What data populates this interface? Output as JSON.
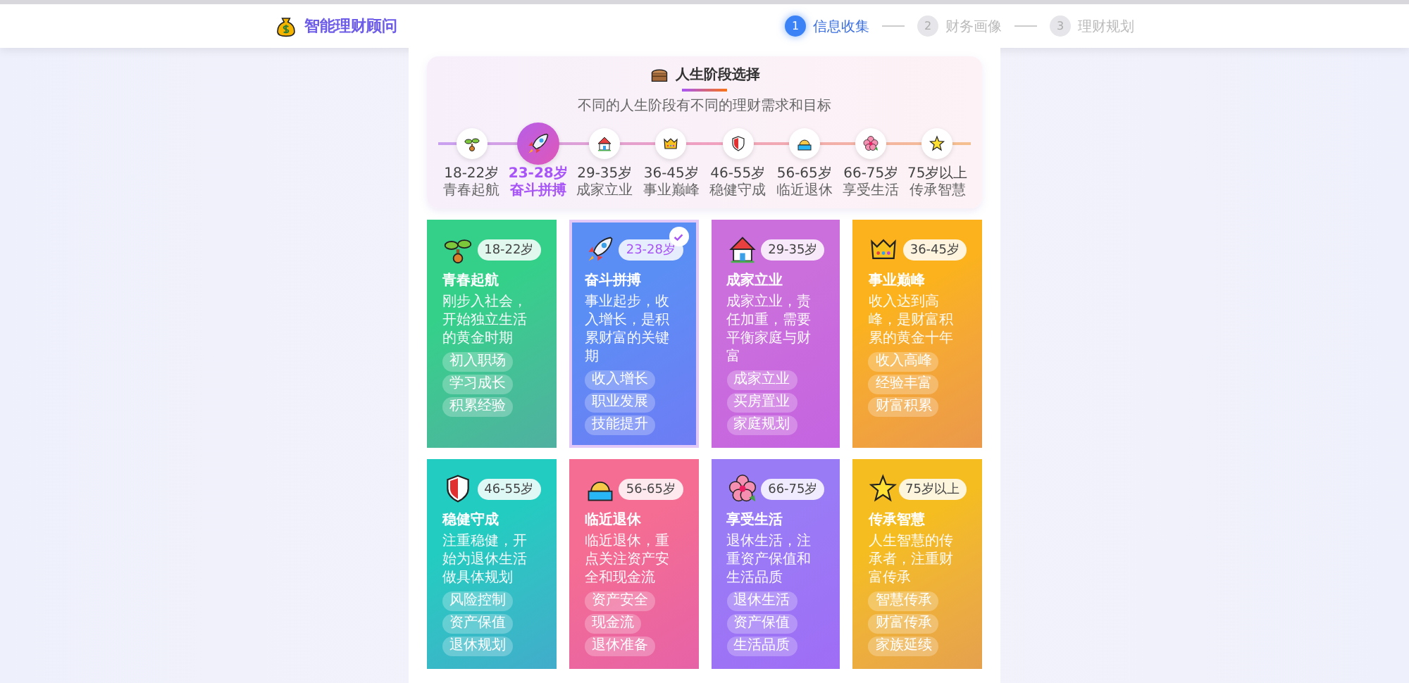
{
  "app": {
    "title": "智能理财顾问"
  },
  "steps": [
    {
      "number": "1",
      "label": "信息收集",
      "selected": true
    },
    {
      "number": "2",
      "label": "财务画像",
      "selected": false
    },
    {
      "number": "3",
      "label": "理财规划",
      "selected": false
    }
  ],
  "stage_selector": {
    "title": "人生阶段选择",
    "subtitle": "不同的人生阶段有不同的理财需求和目标",
    "stages": [
      {
        "age": "18-22岁",
        "name": "青春起航",
        "selected": false
      },
      {
        "age": "23-28岁",
        "name": "奋斗拼搏",
        "selected": true
      },
      {
        "age": "29-35岁",
        "name": "成家立业",
        "selected": false
      },
      {
        "age": "36-45岁",
        "name": "事业巅峰",
        "selected": false
      },
      {
        "age": "46-55岁",
        "name": "稳健守成",
        "selected": false
      },
      {
        "age": "56-65岁",
        "name": "临近退休",
        "selected": false
      },
      {
        "age": "66-75岁",
        "name": "享受生活",
        "selected": false
      },
      {
        "age": "75岁以上",
        "name": "传承智慧",
        "selected": false
      }
    ]
  },
  "cards": [
    {
      "name": "青春起航",
      "age": "18-22岁",
      "description": "刚步入社会，开始独立生活的黄金时期",
      "tags": [
        "初入职场",
        "学习成长",
        "积累经验"
      ],
      "selected": false,
      "color": "#34d08a"
    },
    {
      "name": "奋斗拼搏",
      "age": "23-28岁",
      "description": "事业起步，收入增长，是积累财富的关键期",
      "tags": [
        "收入增长",
        "职业发展",
        "技能提升"
      ],
      "selected": true,
      "color": "#5b8ef5"
    },
    {
      "name": "成家立业",
      "age": "29-35岁",
      "description": "成家立业，责任加重，需要平衡家庭与财富",
      "tags": [
        "成家立业",
        "买房置业",
        "家庭规划"
      ],
      "selected": false,
      "color": "#cb6fdc"
    },
    {
      "name": "事业巅峰",
      "age": "36-45岁",
      "description": "收入达到高峰，是财富积累的黄金十年",
      "tags": [
        "收入高峰",
        "经验丰富",
        "财富积累"
      ],
      "selected": false,
      "color": "#fbb21c"
    },
    {
      "name": "稳健守成",
      "age": "46-55岁",
      "description": "注重稳健，开始为退休生活做具体规划",
      "tags": [
        "风险控制",
        "资产保值",
        "退休规划"
      ],
      "selected": false,
      "color": "#22ccc0"
    },
    {
      "name": "临近退休",
      "age": "56-65岁",
      "description": "临近退休，重点关注资产安全和现金流",
      "tags": [
        "资产安全",
        "现金流",
        "退休准备"
      ],
      "selected": false,
      "color": "#f56d92"
    },
    {
      "name": "享受生活",
      "age": "66-75岁",
      "description": "退休生活，注重资产保值和生活品质",
      "tags": [
        "退休生活",
        "资产保值",
        "生活品质"
      ],
      "selected": false,
      "color": "#9a7bf6"
    },
    {
      "name": "传承智慧",
      "age": "75岁以上",
      "description": "人生智慧的传承者，注重财富传承",
      "tags": [
        "智慧传承",
        "财富传承",
        "家族延续"
      ],
      "selected": false,
      "color": "#f5bd1f"
    }
  ]
}
